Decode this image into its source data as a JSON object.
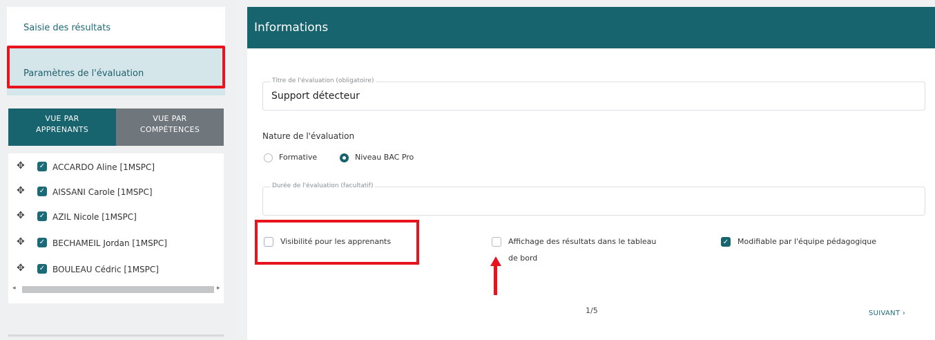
{
  "sidebar": {
    "menu": {
      "saisie_label": "Saisie des résultats",
      "parametres_label": "Paramètres de l'évaluation"
    },
    "tabs": {
      "apprenants_line1": "VUE PAR",
      "apprenants_line2": "APPRENANTS",
      "competences_line1": "VUE PAR",
      "competences_line2": "COMPÉTENCES"
    },
    "students": [
      "ACCARDO Aline [1MSPC]",
      "AISSANI Carole [1MSPC]",
      "AZIL Nicole [1MSPC]",
      "BECHAMEIL Jordan [1MSPC]",
      "BOULEAU Cédric [1MSPC]"
    ]
  },
  "main": {
    "header_title": "Informations",
    "titre_legend": "Titre de l'évaluation (obligatoire)",
    "titre_value": "Support détecteur",
    "nature_label": "Nature de l'évaluation",
    "radio_formative": "Formative",
    "radio_niveau": "Niveau BAC Pro",
    "radio_selected": "Niveau BAC Pro",
    "duree_legend": "Durée de l'évaluation (facultatif)",
    "duree_value": "",
    "cb_visibilite": "Visibilité pour les apprenants",
    "cb_affichage_line1": "Affichage des résultats dans le tableau",
    "cb_affichage_line2": "de bord",
    "cb_modifiable": "Modifiable par l'équipe pédagogique",
    "pager": "1/5",
    "next_label": "SUIVANT ›"
  },
  "colors": {
    "accent": "#17636e",
    "highlight_red": "#e8141d",
    "inactive_tab": "#6f767c",
    "active_menu_bg": "#d4e6ea"
  },
  "icons": [
    "move-icon",
    "checkbox-checked-icon",
    "arrow-left-icon",
    "arrow-right-icon"
  ]
}
